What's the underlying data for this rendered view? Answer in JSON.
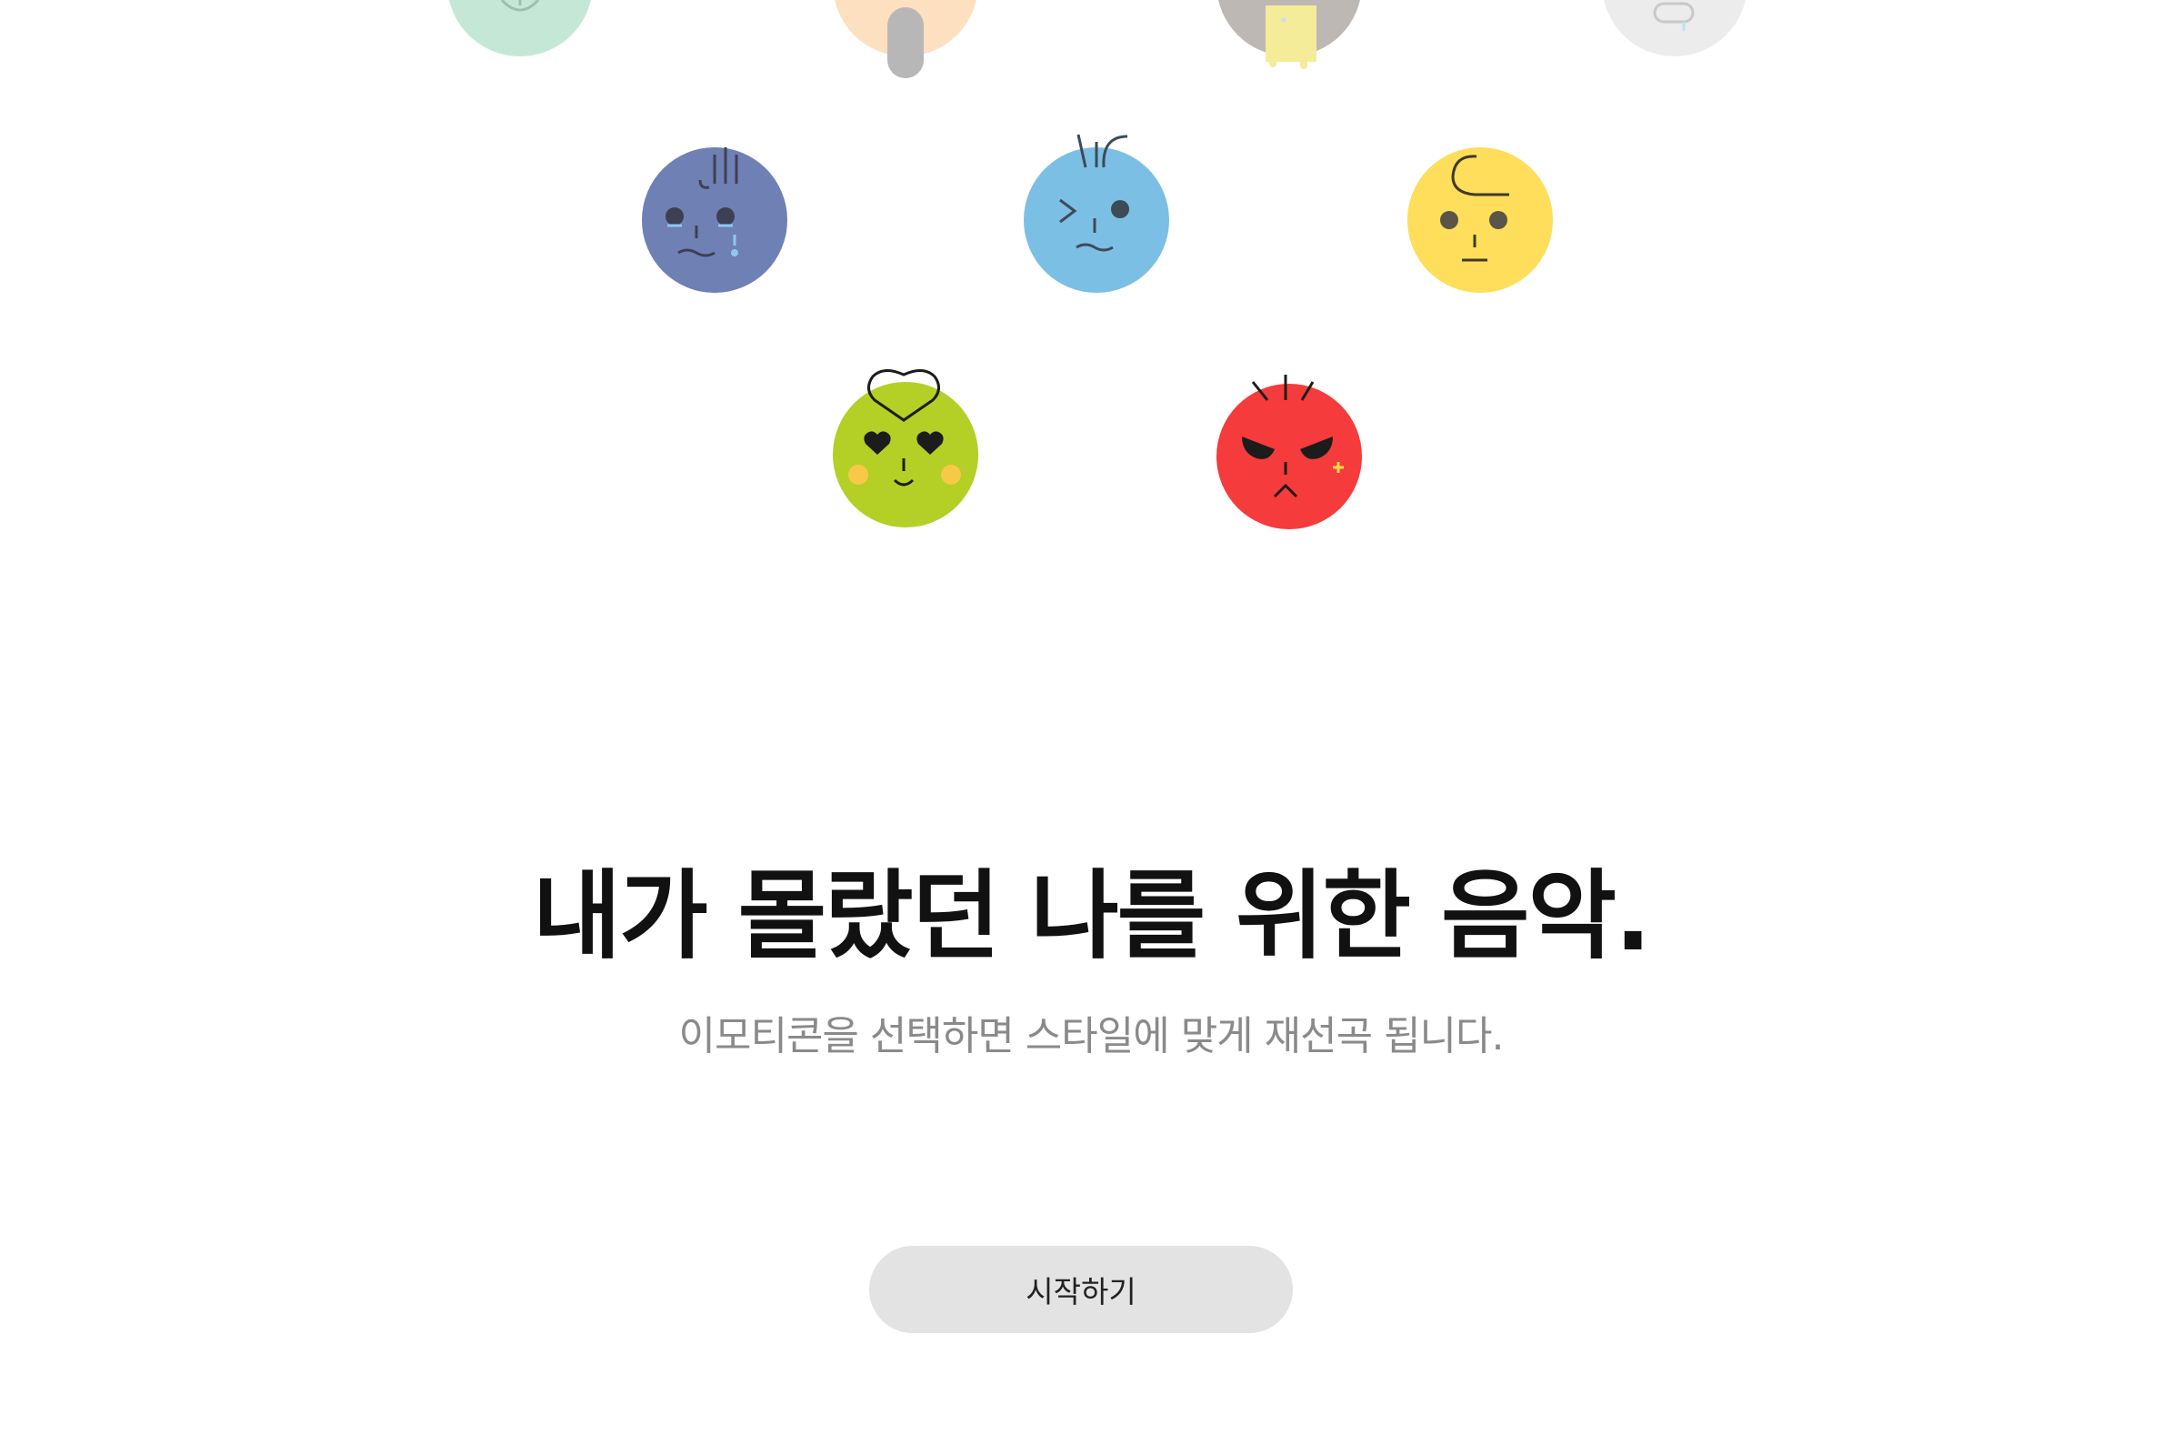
{
  "headline": "내가 몰랐던 나를 위한 음악.",
  "subtitle": "이모티콘을 선택하면 스타일에 맞게 재선곡 됩니다.",
  "start_button_label": "시작하기",
  "colors": {
    "background": "#ffffff",
    "mint": "#c4e8d5",
    "peach": "#fde0c0",
    "taupe": "#bdb8b3",
    "light_gray": "#ececec",
    "indigo": "#6f80b5",
    "sky_blue": "#7cbfe5",
    "yellow": "#fede5a",
    "lime": "#b4cf25",
    "red": "#f53b3b",
    "button_bg": "#e3e3e3"
  },
  "emoticons": [
    {
      "name": "mint-smile",
      "icon": "partially-visible-mint-face-icon"
    },
    {
      "name": "peach",
      "icon": "partially-visible-peach-face-icon"
    },
    {
      "name": "taupe",
      "icon": "partially-visible-taupe-face-icon"
    },
    {
      "name": "gray",
      "icon": "partially-visible-gray-face-icon"
    },
    {
      "name": "sad",
      "icon": "crying-face-icon"
    },
    {
      "name": "wink",
      "icon": "winking-face-icon"
    },
    {
      "name": "calm",
      "icon": "neutral-face-icon"
    },
    {
      "name": "love",
      "icon": "heart-eyes-face-icon"
    },
    {
      "name": "angry",
      "icon": "angry-face-icon"
    }
  ]
}
